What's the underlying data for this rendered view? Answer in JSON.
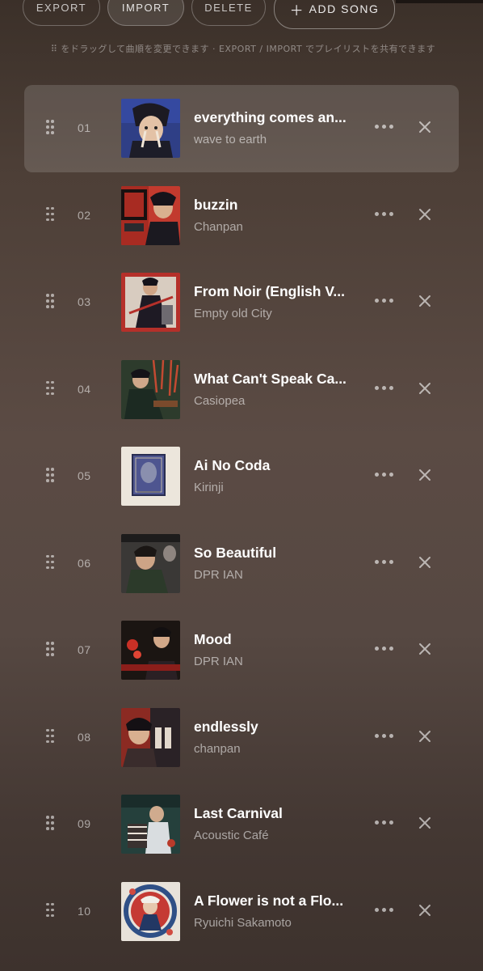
{
  "toolbar": {
    "export_label": "EXPORT",
    "import_label": "IMPORT",
    "delete_label": "DELETE",
    "add_label": "ADD SONG",
    "add_icon": "＋"
  },
  "hint": "⠿ をドラッグして曲順を変更できます · EXPORT / IMPORT でプレイリストを共有できます",
  "playlist": [
    {
      "num": "01",
      "title": "everything comes an...",
      "artist": "wave to earth",
      "selected": true
    },
    {
      "num": "02",
      "title": "buzzin",
      "artist": "Chanpan"
    },
    {
      "num": "03",
      "title": "From Noir (English V...",
      "artist": "Empty old City"
    },
    {
      "num": "04",
      "title": "What Can't Speak Ca...",
      "artist": "Casiopea"
    },
    {
      "num": "05",
      "title": "Ai No Coda",
      "artist": "Kirinji"
    },
    {
      "num": "06",
      "title": "So Beautiful",
      "artist": "DPR IAN"
    },
    {
      "num": "07",
      "title": "Mood",
      "artist": "DPR IAN"
    },
    {
      "num": "08",
      "title": "endlessly",
      "artist": "chanpan"
    },
    {
      "num": "09",
      "title": "Last Carnival",
      "artist": "Acoustic Café"
    },
    {
      "num": "10",
      "title": "A Flower is not a Flo...",
      "artist": "Ryuichi Sakamoto"
    }
  ],
  "icons": {
    "drag": "drag-handle-icon",
    "more": "more-options-icon",
    "remove": "close-icon"
  },
  "colors": {
    "accent": "#ffffff",
    "muted": "#a8998f",
    "selected_row": "#6b5d56"
  }
}
